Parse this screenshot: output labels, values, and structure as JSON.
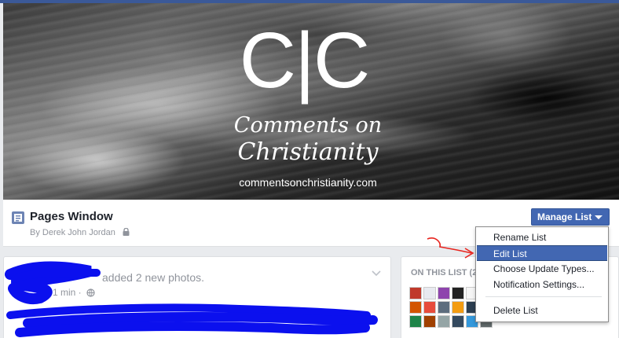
{
  "cover": {
    "logo_mark": "C|C",
    "logo_line1": "Comments on",
    "logo_line2": "Christianity",
    "logo_url": "commentsonchristianity.com"
  },
  "list_header": {
    "title": "Pages Window",
    "byline": "By Derek John Jordan",
    "manage_button": "Manage List"
  },
  "dropdown": {
    "items": [
      {
        "label": "Rename List"
      },
      {
        "label": "Edit List"
      },
      {
        "label": "Choose Update Types..."
      },
      {
        "label": "Notification Settings..."
      },
      {
        "label": "Delete List"
      }
    ],
    "active_index": 1
  },
  "feed": {
    "post_text": "added 2 new photos.",
    "post_time": "1 min ·"
  },
  "sidebar": {
    "title": "ON THIS LIST (2"
  },
  "colors": {
    "brand": "#3b5998",
    "button": "#4267b2",
    "scribble": "#0b10ee",
    "annotation": "#e8241e"
  }
}
